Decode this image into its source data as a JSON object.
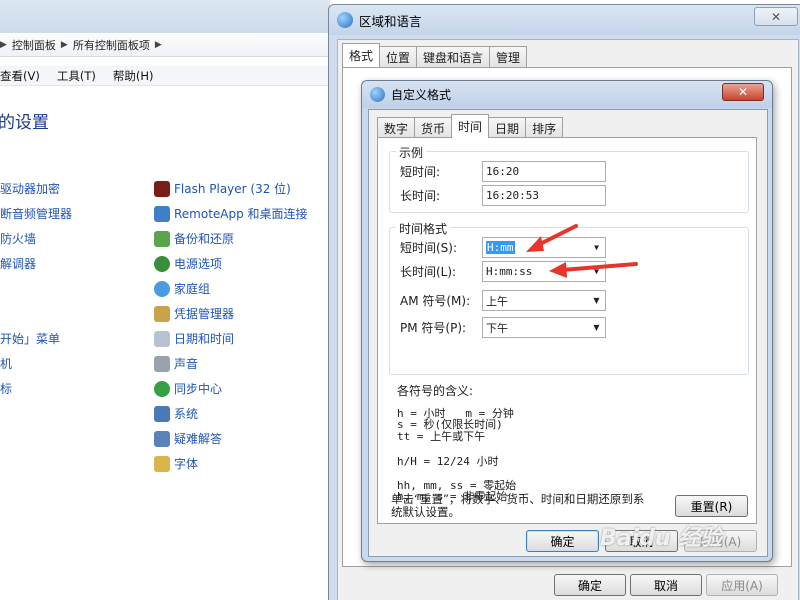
{
  "control_panel": {
    "breadcrumb": [
      "控制面板",
      "所有控制面板项"
    ],
    "menu": [
      "查看(V)",
      "工具(T)",
      "帮助(H)"
    ],
    "heading": "的设置",
    "left_items": [
      "驱动器加密",
      "断音频管理器",
      "防火墙",
      "解调器",
      "",
      "",
      "开始」菜单",
      "机",
      "标"
    ],
    "right_items": [
      "Flash Player (32 位)",
      "RemoteApp 和桌面连接",
      "备份和还原",
      "电源选项",
      "家庭组",
      "凭据管理器",
      "日期和时间",
      "声音",
      "同步中心",
      "系统",
      "疑难解答",
      "字体"
    ]
  },
  "region_dialog": {
    "title": "区域和语言",
    "close": "✕",
    "tabs": [
      "格式",
      "位置",
      "键盘和语言",
      "管理"
    ],
    "buttons": {
      "ok": "确定",
      "cancel": "取消",
      "apply": "应用(A)"
    }
  },
  "custom_dialog": {
    "title": "自定义格式",
    "close": "✕",
    "tabs": [
      "数字",
      "货币",
      "时间",
      "日期",
      "排序"
    ],
    "active_tab": "时间",
    "example": {
      "group_title": "示例",
      "short_label": "短时间:",
      "short_value": "16:20",
      "long_label": "长时间:",
      "long_value": "16:20:53"
    },
    "time_formats": {
      "group_title": "时间格式",
      "short_label": "短时间(S):",
      "short_value": "H:mm",
      "long_label": "长时间(L):",
      "long_value": "H:mm:ss",
      "am_label": "AM 符号(M):",
      "am_value": "上午",
      "pm_label": "PM 符号(P):",
      "pm_value": "下午"
    },
    "legend_title": "各符号的含义:",
    "legend_lines": [
      "h = 小时   m = 分钟",
      "s = 秒(仅限长时间)",
      "tt = 上午或下午",
      "h/H = 12/24 小时",
      "hh, mm, ss = 零起始",
      "h, m, s = 非零起始"
    ],
    "reset_text_1": "单击“重置”，将数字、货币、时间和日期还原到系",
    "reset_text_2": "统默认设置。",
    "reset_button": "重置(R)",
    "buttons": {
      "ok": "确定",
      "cancel": "取消",
      "apply": "应用(A)"
    }
  },
  "watermark": "Baidu 经验",
  "colors": {
    "link": "#1f55b2",
    "selection": "#3399ff",
    "arrow": "#e8352b"
  }
}
